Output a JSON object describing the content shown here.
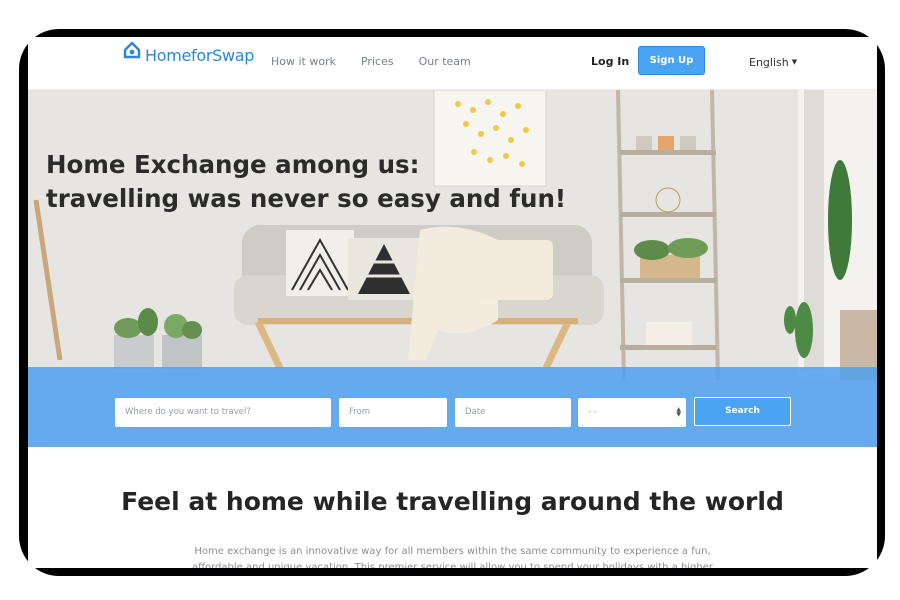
{
  "brand": {
    "name": "HomeforSwap",
    "color": "#2f86d6"
  },
  "nav": {
    "links": [
      "How it work",
      "Prices",
      "Our team"
    ],
    "login": "Log In",
    "signup": "Sign Up",
    "language": "English"
  },
  "hero": {
    "title_line1": "Home Exchange among us:",
    "title_line2": "travelling was never so easy and fun!"
  },
  "search": {
    "destination_placeholder": "Where do you want to travel?",
    "from_placeholder": "From",
    "date_placeholder": "Date",
    "select_value": "- -",
    "button": "Search"
  },
  "section": {
    "title": "Feel at home while travelling around the world",
    "body": "Home exchange is an innovative way for all members within the same community to experience a fun, affordable and unique vacation. This premier service will allow you to spend your holidays with a higher level of comfort, extra"
  },
  "colors": {
    "accent": "#4ba4f3",
    "search_band": "#4da0ee"
  }
}
